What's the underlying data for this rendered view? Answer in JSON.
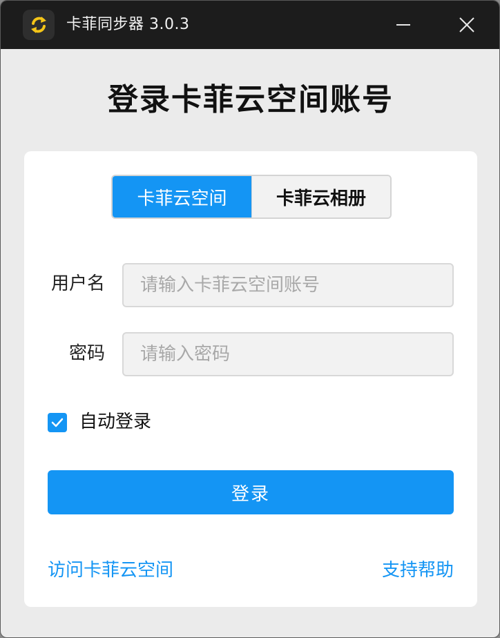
{
  "window": {
    "title": "卡菲同步器 3.0.3",
    "app_icon": "sync-arrows-icon",
    "minimize_icon": "minimize-icon",
    "close_icon": "close-icon"
  },
  "login": {
    "heading": "登录卡菲云空间账号",
    "tabs": [
      {
        "label": "卡菲云空间",
        "selected": true
      },
      {
        "label": "卡菲云相册",
        "selected": false
      }
    ],
    "username": {
      "label": "用户名",
      "value": "",
      "placeholder": "请输入卡菲云空间账号"
    },
    "password": {
      "label": "密码",
      "value": "",
      "placeholder": "请输入密码"
    },
    "auto_login": {
      "label": "自动登录",
      "checked": true
    },
    "submit_label": "登录",
    "links": {
      "visit": "访问卡菲云空间",
      "help": "支持帮助"
    }
  },
  "colors": {
    "accent": "#1495f4",
    "titlebar": "#1c1c1c",
    "background": "#ebebeb",
    "icon_gold": "#f5c518"
  }
}
